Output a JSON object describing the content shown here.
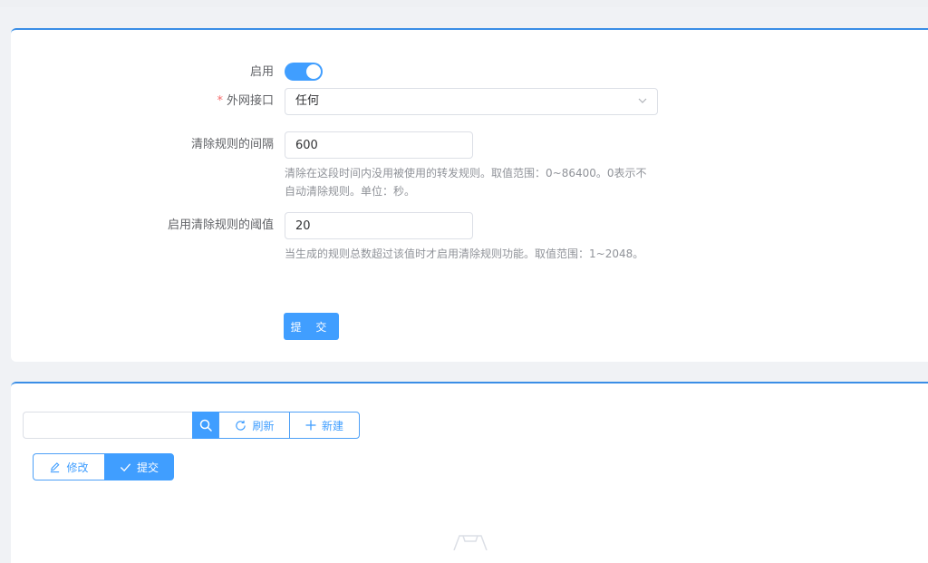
{
  "settings": {
    "enable_label": "启用",
    "enabled": true,
    "wan_label": "外网接口",
    "wan_required_mark": "*",
    "wan_value": "任何",
    "interval_label": "清除规则的间隔",
    "interval_value": "600",
    "interval_hint": "清除在这段时间内没用被使用的转发规则。取值范围：0~86400。0表示不自动清除规则。单位：秒。",
    "threshold_label": "启用清除规则的阈值",
    "threshold_value": "20",
    "threshold_hint": "当生成的规则总数超过该值时才启用清除规则功能。取值范围：1~2048。",
    "submit_label": "提 交"
  },
  "toolbar": {
    "search_value": "",
    "refresh_label": "刷新",
    "create_label": "新建",
    "edit_label": "修改",
    "submit_label": "提交"
  },
  "colors": {
    "primary": "#409eff",
    "accent_border": "#3a8ee6"
  }
}
